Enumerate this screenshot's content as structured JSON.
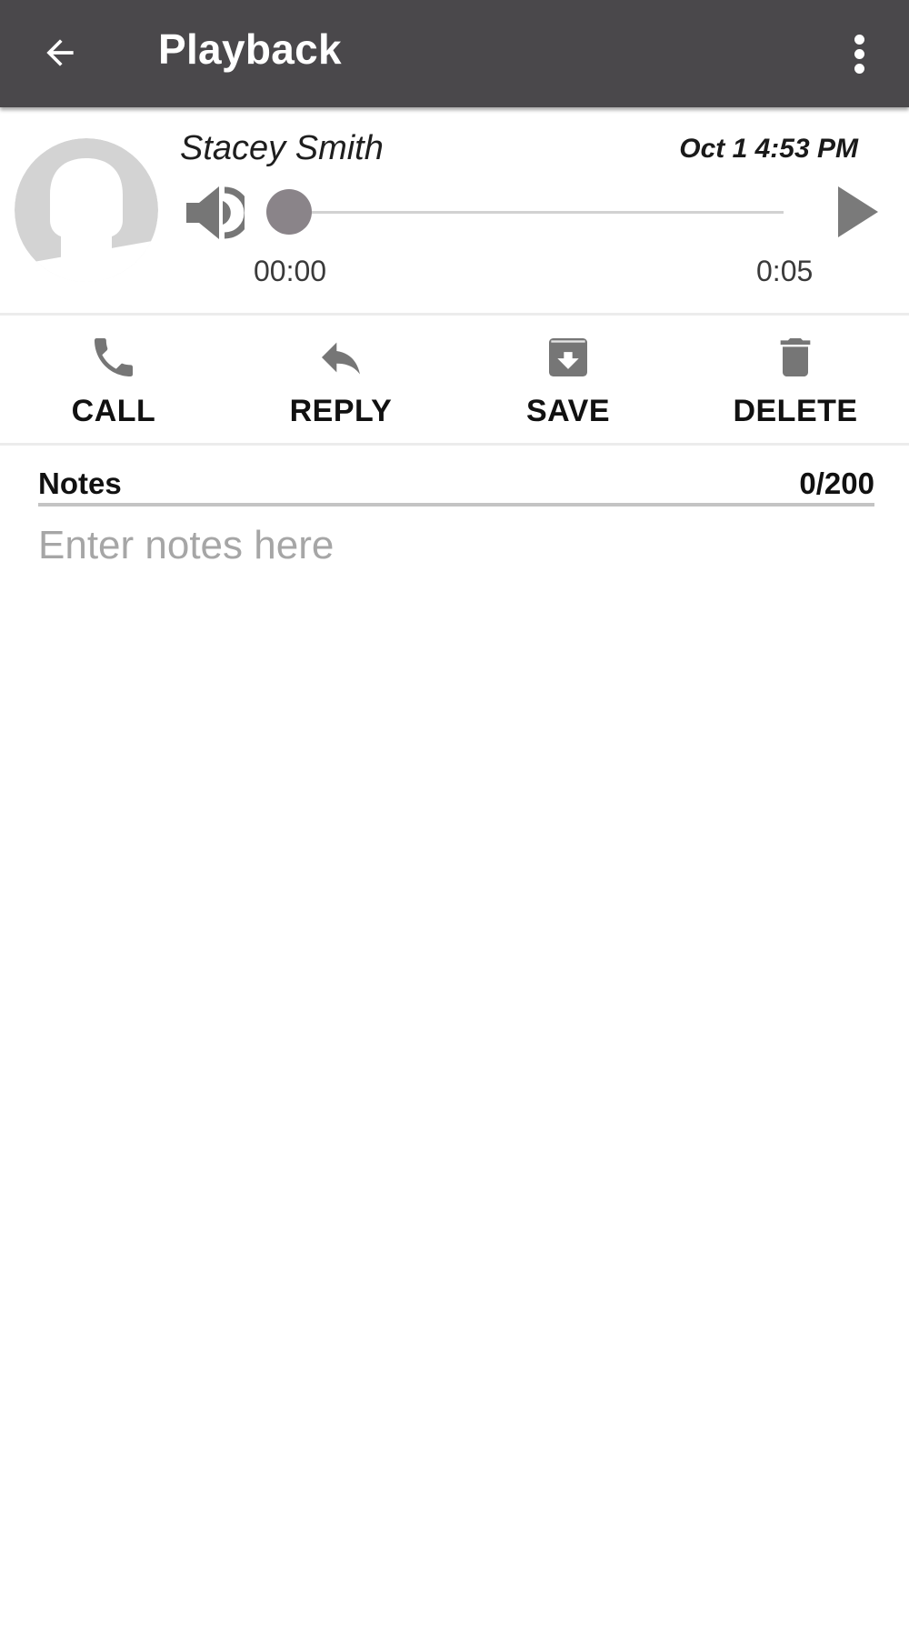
{
  "app_bar": {
    "title": "Playback",
    "back_icon": "arrow-left-icon",
    "menu_icon": "more-vert-icon",
    "background": "#4a484b"
  },
  "player": {
    "contact_name": "Stacey Smith",
    "date": "Oct 1 4:53 PM",
    "avatar_icon": "person-placeholder-icon",
    "volume_icon": "volume-icon",
    "play_icon": "play-icon",
    "current_time": "00:00",
    "total_time": "0:05",
    "progress": 0,
    "accent": "#8a8489"
  },
  "actions": [
    {
      "id": "call",
      "label": "CALL",
      "icon": "phone-icon"
    },
    {
      "id": "reply",
      "label": "REPLY",
      "icon": "reply-icon"
    },
    {
      "id": "save",
      "label": "SAVE",
      "icon": "archive-icon"
    },
    {
      "id": "delete",
      "label": "DELETE",
      "icon": "trash-icon"
    }
  ],
  "notes": {
    "label": "Notes",
    "count": "0/200",
    "value": "",
    "placeholder": "Enter notes here"
  }
}
